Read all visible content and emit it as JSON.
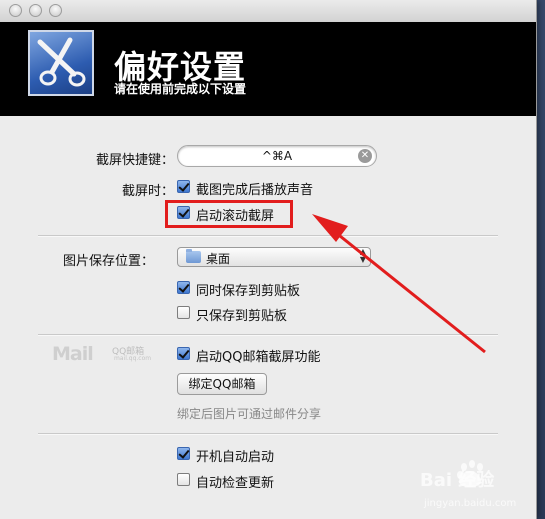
{
  "window": {
    "title": "偏好设置",
    "subtitle": "请在使用前完成以下设置"
  },
  "hotkey": {
    "label": "截屏快捷键：",
    "value": "^⌘A"
  },
  "screenshot": {
    "label": "截屏时：",
    "options": [
      {
        "label": "截图完成后播放声音",
        "checked": true
      },
      {
        "label": "启动滚动截屏",
        "checked": true
      }
    ]
  },
  "save_location": {
    "label": "图片保存位置：",
    "selected": "桌面",
    "options": [
      {
        "label": "同时保存到剪贴板",
        "checked": true
      },
      {
        "label": "只保存到剪贴板",
        "checked": false
      }
    ]
  },
  "qqmail": {
    "logo_text": "Mail",
    "logo_sub": "QQ邮箱",
    "logo_url": "mail.qq.com",
    "option": {
      "label": "启动QQ邮箱截屏功能",
      "checked": true
    },
    "bind_button": "绑定QQ邮箱",
    "hint": "绑定后图片可通过邮件分享"
  },
  "startup": {
    "options": [
      {
        "label": "开机自动启动",
        "checked": true
      },
      {
        "label": "自动检查更新",
        "checked": false
      }
    ]
  },
  "watermark": {
    "text": "Bai 经验",
    "url": "jingyan.baidu.com"
  },
  "colors": {
    "annotation_red": "#e21d1d",
    "checkbox_blue": "#3f78d0",
    "header_black": "#000000"
  }
}
